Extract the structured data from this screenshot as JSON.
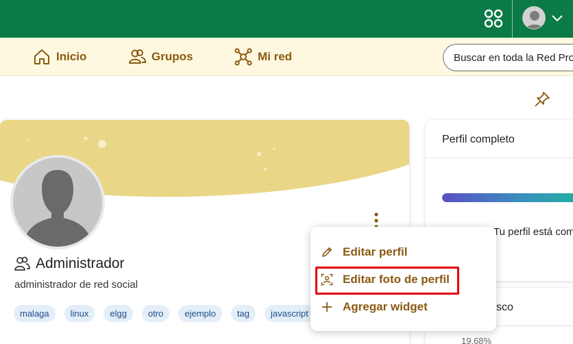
{
  "colors": {
    "topbar": "#0b7a46",
    "navbar": "#fdf8df",
    "accent": "#8a5a12",
    "cover": "#e9d686",
    "tag_bg": "#e3eef9",
    "tag_text": "#1d4e86",
    "highlight": "#e10000"
  },
  "topbar": {
    "apps_icon": "apps-grid-icon",
    "user_icon": "avatar",
    "chevron_icon": "chevron-down-icon"
  },
  "nav": {
    "items": [
      {
        "label": "Inicio",
        "icon": "home-icon"
      },
      {
        "label": "Grupos",
        "icon": "groups-icon"
      },
      {
        "label": "Mi red",
        "icon": "network-icon"
      }
    ],
    "search_text": "Buscar en toda la Red Profe"
  },
  "profile": {
    "name": "Administrador",
    "description": "administrador de red social",
    "tags": [
      "malaga",
      "linux",
      "elgg",
      "otro",
      "ejemplo",
      "tag",
      "javascript"
    ]
  },
  "dropdown": {
    "items": [
      {
        "label": "Editar perfil",
        "icon": "pencil-icon"
      },
      {
        "label": "Editar foto de perfil",
        "icon": "portrait-icon"
      },
      {
        "label": "Agregar widget",
        "icon": "plus-icon"
      }
    ]
  },
  "sidebar": {
    "profile_card": {
      "title": "Perfil completo",
      "status": "Tu perfil está com",
      "progress": 0.95
    },
    "second_card": {
      "title_fragment": "sco",
      "percent": "19.68%"
    }
  }
}
